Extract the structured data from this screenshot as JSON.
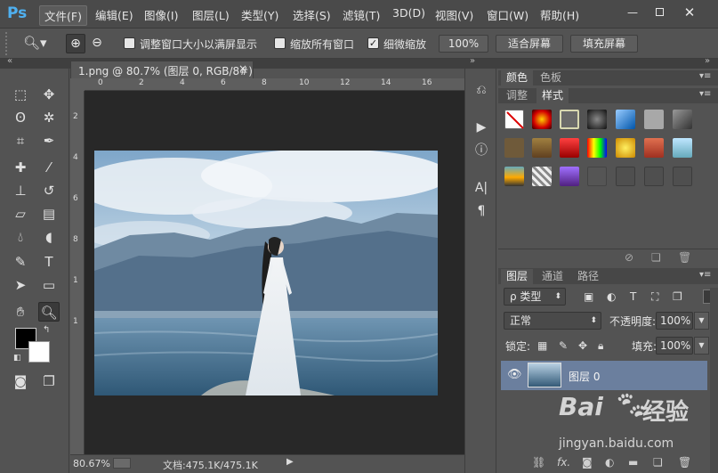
{
  "app": {
    "logo": "Ps"
  },
  "menu": [
    {
      "label": "文件(F)"
    },
    {
      "label": "编辑(E)"
    },
    {
      "label": "图像(I)"
    },
    {
      "label": "图层(L)"
    },
    {
      "label": "类型(Y)"
    },
    {
      "label": "选择(S)"
    },
    {
      "label": "滤镜(T)"
    },
    {
      "label": "3D(D)"
    },
    {
      "label": "视图(V)"
    },
    {
      "label": "窗口(W)"
    },
    {
      "label": "帮助(H)"
    }
  ],
  "options": {
    "resize_windows": "调整窗口大小以满屏显示",
    "zoom_all": "缩放所有窗口",
    "scrubby_zoom": "细微缩放",
    "btn_100": "100%",
    "btn_fit": "适合屏幕",
    "btn_fill": "填充屏幕"
  },
  "document": {
    "tab_title": "1.png @ 80.7% (图层 0, RGB/8#)",
    "close": "×",
    "ruler_h": [
      "0",
      "2",
      "4",
      "6",
      "8",
      "10",
      "12",
      "14",
      "16"
    ],
    "ruler_v": [
      "2",
      "4",
      "6",
      "8",
      "1",
      "1"
    ]
  },
  "status": {
    "zoom": "80.67%",
    "doc": "文档:475.1K/475.1K"
  },
  "panels": {
    "top_tabs": [
      "颜色",
      "色板"
    ],
    "second_tabs": [
      "调整",
      "样式"
    ],
    "layers_tabs": [
      "图层",
      "通道",
      "路径"
    ],
    "kind": "ρ 类型",
    "blend": "正常",
    "opacity_label": "不透明度:",
    "opacity_value": "100%",
    "lock_label": "锁定:",
    "fill_label": "填充:",
    "fill_value": "100%",
    "layer_name": "图层 0"
  },
  "watermark": {
    "brand": "Bai",
    "brand2": "经验",
    "url": "jingyan.baidu.com"
  }
}
